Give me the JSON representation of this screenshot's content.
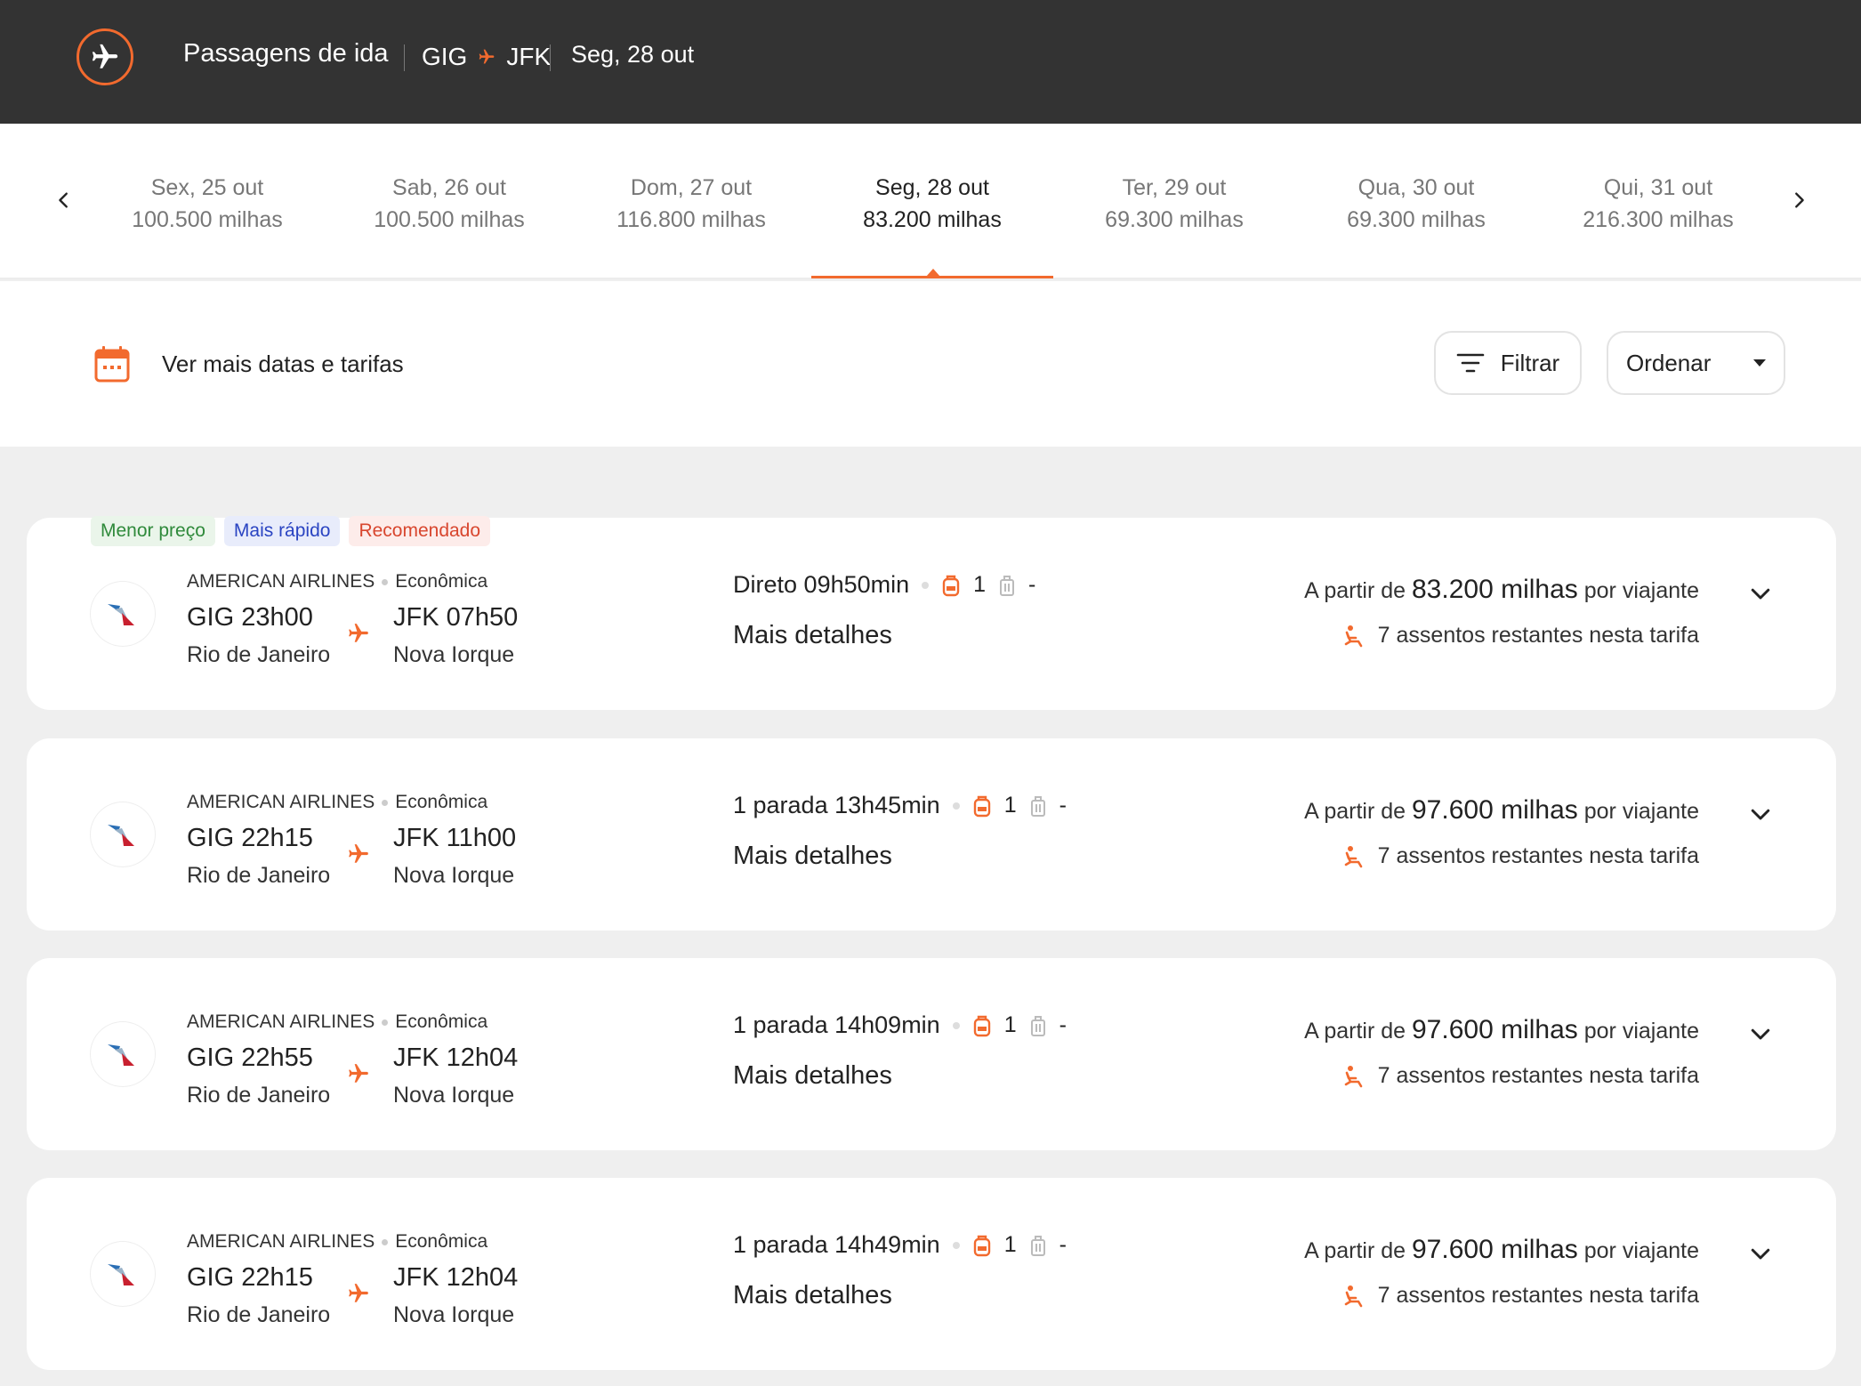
{
  "header": {
    "title": "Passagens de ida",
    "origin": "GIG",
    "destination": "JFK",
    "date": "Seg, 28 out"
  },
  "colors": {
    "accent": "#f26a2e",
    "header_bg": "#333333"
  },
  "date_strip": {
    "prev_icon": "chevron-left-icon",
    "next_icon": "chevron-right-icon",
    "dates": [
      {
        "day": "Sex, 25 out",
        "miles": "100.500 milhas",
        "active": false
      },
      {
        "day": "Sab, 26 out",
        "miles": "100.500 milhas",
        "active": false
      },
      {
        "day": "Dom, 27 out",
        "miles": "116.800 milhas",
        "active": false
      },
      {
        "day": "Seg, 28 out",
        "miles": "83.200 milhas",
        "active": true
      },
      {
        "day": "Ter, 29 out",
        "miles": "69.300 milhas",
        "active": false
      },
      {
        "day": "Qua, 30 out",
        "miles": "69.300 milhas",
        "active": false
      },
      {
        "day": "Qui, 31 out",
        "miles": "216.300 milhas",
        "active": false
      }
    ]
  },
  "toolbar": {
    "more_dates": "Ver mais datas e tarifas",
    "filter_label": "Filtrar",
    "order_label": "Ordenar"
  },
  "flights": [
    {
      "tags": [
        "Menor preço",
        "Mais rápido",
        "Recomendado"
      ],
      "airline": "AMERICAN AIRLINES",
      "cabin": "Econômica",
      "dep_time": "GIG 23h00",
      "dep_city": "Rio de Janeiro",
      "arr_time": "JFK 07h50",
      "arr_city": "Nova Iorque",
      "stops": "Direto",
      "duration": "09h50min",
      "carry_on": "1",
      "checked": "-",
      "details": "Mais detalhes",
      "price_prefix": "A partir de",
      "price": "83.200 milhas",
      "price_suffix": "por viajante",
      "seats": "7 assentos restantes nesta tarifa"
    },
    {
      "tags": [],
      "airline": "AMERICAN AIRLINES",
      "cabin": "Econômica",
      "dep_time": "GIG 22h15",
      "dep_city": "Rio de Janeiro",
      "arr_time": "JFK 11h00",
      "arr_city": "Nova Iorque",
      "stops": "1 parada",
      "duration": "13h45min",
      "carry_on": "1",
      "checked": "-",
      "details": "Mais detalhes",
      "price_prefix": "A partir de",
      "price": "97.600 milhas",
      "price_suffix": "por viajante",
      "seats": "7 assentos restantes nesta tarifa"
    },
    {
      "tags": [],
      "airline": "AMERICAN AIRLINES",
      "cabin": "Econômica",
      "dep_time": "GIG 22h55",
      "dep_city": "Rio de Janeiro",
      "arr_time": "JFK 12h04",
      "arr_city": "Nova Iorque",
      "stops": "1 parada",
      "duration": "14h09min",
      "carry_on": "1",
      "checked": "-",
      "details": "Mais detalhes",
      "price_prefix": "A partir de",
      "price": "97.600 milhas",
      "price_suffix": "por viajante",
      "seats": "7 assentos restantes nesta tarifa"
    },
    {
      "tags": [],
      "airline": "AMERICAN AIRLINES",
      "cabin": "Econômica",
      "dep_time": "GIG 22h15",
      "dep_city": "Rio de Janeiro",
      "arr_time": "JFK 12h04",
      "arr_city": "Nova Iorque",
      "stops": "1 parada",
      "duration": "14h49min",
      "carry_on": "1",
      "checked": "-",
      "details": "Mais detalhes",
      "price_prefix": "A partir de",
      "price": "97.600 milhas",
      "price_suffix": "por viajante",
      "seats": "7 assentos restantes nesta tarifa"
    }
  ]
}
